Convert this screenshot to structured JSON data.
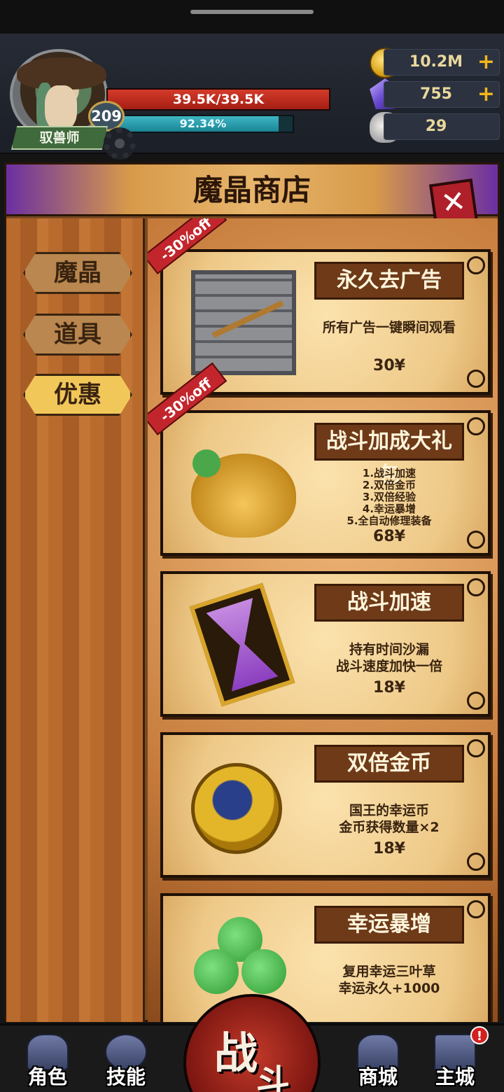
{
  "player": {
    "class_name": "驭兽师",
    "level": "209",
    "hp_text": "39.5K/39.5K",
    "hp_fraction": 1.0,
    "xp_text": "92.34%",
    "xp_fraction": 0.9234
  },
  "resources": {
    "gold": "10.2M",
    "crystals": "755",
    "skulls": "29",
    "plus": "+"
  },
  "shop": {
    "title": "魔晶商店",
    "close_symbol": "✕",
    "tabs": [
      {
        "label": "魔晶",
        "active": false
      },
      {
        "label": "道具",
        "active": false
      },
      {
        "label": "优惠",
        "active": true
      }
    ],
    "items": [
      {
        "title": "永久去广告",
        "desc": "所有广告一键瞬间观看",
        "price": "30¥",
        "discount": "-30%off"
      },
      {
        "title": "战斗加成大礼包",
        "desc": "1.战斗加速\n2.双倍金币\n3.双倍经验\n4.幸运暴增\n5.全自动修理装备",
        "price": "68¥",
        "discount": "-30%off"
      },
      {
        "title": "战斗加速",
        "desc": "持有时间沙漏\n战斗速度加快一倍",
        "price": "18¥"
      },
      {
        "title": "双倍金币",
        "desc": "国王的幸运币\n金币获得数量×2",
        "price": "18¥"
      },
      {
        "title": "幸运暴增",
        "desc": "复用幸运三叶草\n幸运永久+1000"
      }
    ]
  },
  "nav": {
    "role": "角色",
    "skills": "技能",
    "fight_1": "战",
    "fight_2": "斗",
    "store": "商城",
    "main_city": "主城",
    "alert": "!"
  },
  "colors": {
    "accent_gold": "#f2b61c",
    "hp_red": "#c22a1e",
    "xp_cyan": "#2fa3b3",
    "active_tab": "#f1c75a"
  }
}
